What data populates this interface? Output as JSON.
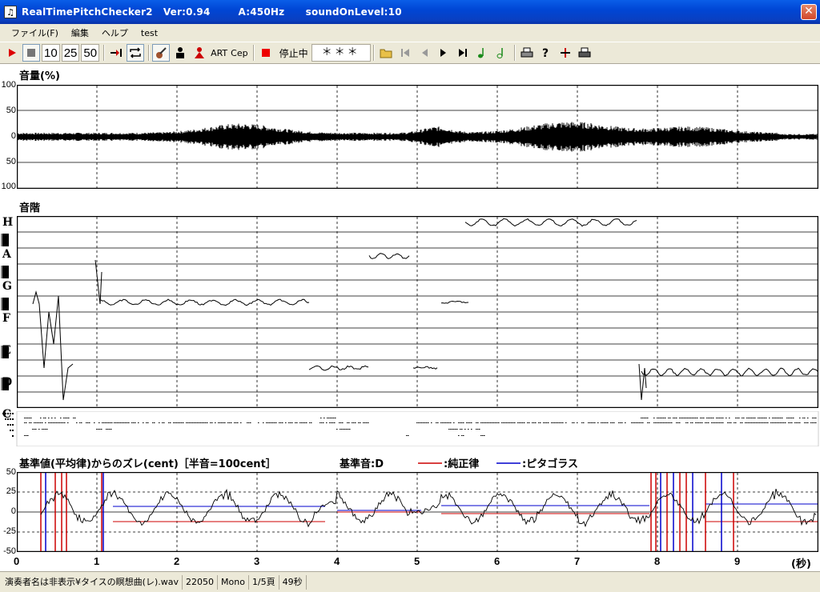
{
  "window": {
    "title": "RealTimePitchChecker2   Ver:0.94        A:450Hz      soundOnLevel:10",
    "close_glyph": "✕"
  },
  "menu": [
    "ファイル(F)",
    "編集",
    "ヘルプ",
    "test"
  ],
  "toolbar": {
    "play_icon": "play-icon",
    "stop_icon": "stop-icon",
    "spans": [
      "10",
      "25",
      "50"
    ],
    "status_text": "停止中",
    "note_display": "＊＊＊",
    "art_label": "ART",
    "cep_label": "Cep"
  },
  "volume_panel": {
    "label": "音量(%)",
    "y_ticks": [
      "100",
      "50",
      "0",
      "50",
      "100"
    ]
  },
  "scale_panel": {
    "label": "音階",
    "notes": [
      "H",
      "A",
      "G",
      "F",
      "E",
      "D",
      "C"
    ]
  },
  "deviation_panel": {
    "label": "基準値(平均律)からのズレ(cent)［半音=100cent］",
    "ref_label": "基準音:D",
    "legend": [
      {
        "name": ":純正律",
        "color": "#cc0000"
      },
      {
        "name": ":ピタゴラス",
        "color": "#0000cc"
      }
    ],
    "y_ticks": [
      "50",
      "25",
      "0",
      "-25",
      "-50"
    ]
  },
  "time_axis": {
    "ticks": [
      "0",
      "1",
      "2",
      "3",
      "4",
      "5",
      "6",
      "7",
      "8",
      "9"
    ],
    "unit": "(秒)"
  },
  "statusbar": [
    "演奏者名は非表示¥タイスの瞑想曲(レ).wav",
    "22050",
    "Mono",
    "1/5頁",
    "49秒"
  ]
}
